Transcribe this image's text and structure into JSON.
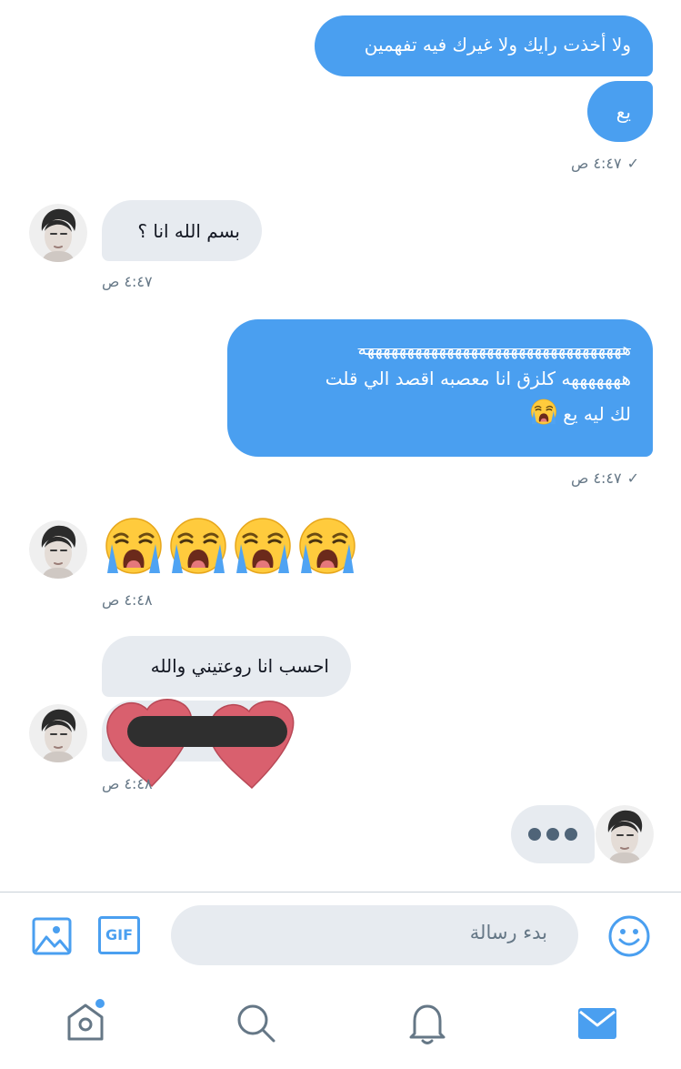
{
  "messages": {
    "m1": {
      "text": "ولا أخذت رايك ولا غيرك فيه تفهمين"
    },
    "m2": {
      "text": "يع"
    },
    "t1": {
      "time": "٤:٤٧ ص",
      "check": "✓"
    },
    "m3": {
      "text": "بسم الله انا ؟"
    },
    "t2": {
      "time": "٤:٤٧ ص"
    },
    "m4": {
      "line1": "هههههههههههههههههههههههههههههههههه",
      "line2": "هههههههه كلزق انا معصبه اقصد الي قلت",
      "line3": "لك ليه يع"
    },
    "t3": {
      "time": "٤:٤٧ ص",
      "check": "✓"
    },
    "t4": {
      "time": "٤:٤٨ ص"
    },
    "m6": {
      "text": "احسب انا روعتيني والله"
    },
    "t5": {
      "time": "٤:٤٨ ص"
    }
  },
  "composer": {
    "placeholder": "بدء رسالة",
    "gif_label": "GIF"
  },
  "colors": {
    "accent": "#4a9ff0",
    "incoming_bubble": "#e7ebf0",
    "meta": "#657786",
    "sticker_heart": "#d9606e"
  },
  "icons": {
    "composer": [
      "image-icon",
      "gif-icon",
      "emoji-icon"
    ],
    "nav": [
      "home-icon",
      "search-icon",
      "notifications-icon",
      "messages-icon"
    ]
  }
}
